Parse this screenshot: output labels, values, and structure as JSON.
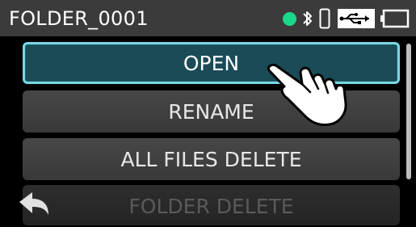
{
  "header": {
    "title": "FOLDER_0001",
    "status_icons": [
      "status-dot-green",
      "bluetooth-icon",
      "phone-icon",
      "usb-power-icon",
      "battery-icon"
    ],
    "status_dot_color": "#19d88a"
  },
  "menu": {
    "items": [
      {
        "label": "OPEN",
        "selected": true
      },
      {
        "label": "RENAME",
        "selected": false
      },
      {
        "label": "ALL FILES DELETE",
        "selected": false
      },
      {
        "label": "FOLDER DELETE",
        "selected": false
      }
    ]
  },
  "controls": {
    "back_icon": "back-arrow-icon",
    "pointer_icon": "touch-hand-icon"
  },
  "colors": {
    "selected_border": "#7ad6e6",
    "selected_fill": "#1a4b57"
  }
}
